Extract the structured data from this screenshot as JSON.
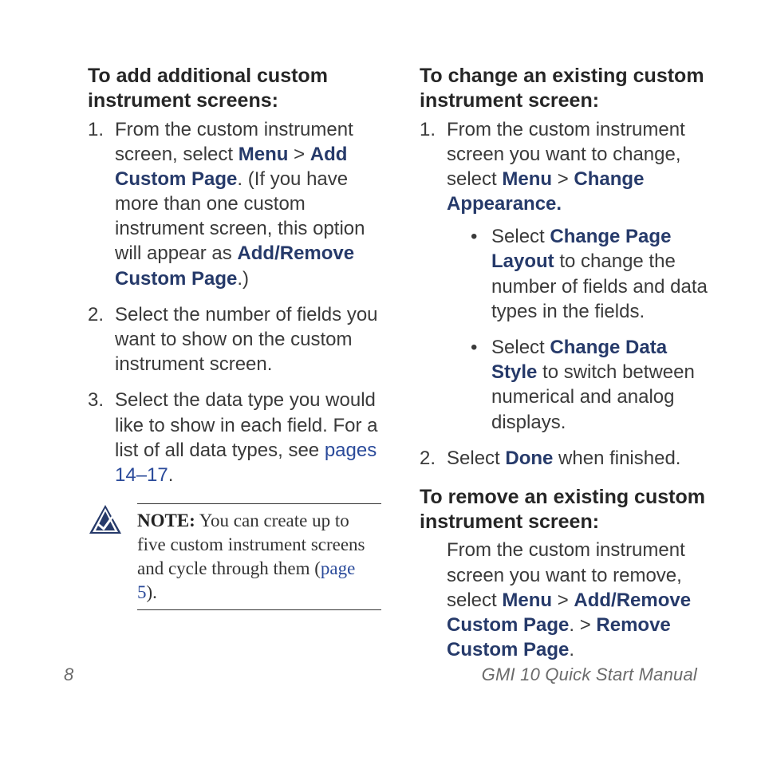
{
  "footer": {
    "page_number": "8",
    "manual_title": "GMI 10 Quick Start Manual"
  },
  "colors": {
    "ui_term": "#263a6a",
    "link": "#2a4a9a"
  },
  "note": {
    "label": "NOTE:",
    "text_pre": " You can create up to five custom instrument screens and cycle through them (",
    "link": "page 5",
    "text_post": ")."
  },
  "left": {
    "heading": "To add additional custom instrument screens:",
    "step1": {
      "t0": "From the custom instrument screen, select ",
      "ui0": "Menu",
      "t1": " > ",
      "ui1": "Add Custom Page",
      "t2": ". (If you have more than one custom instrument screen, this option will appear as ",
      "ui2": "Add/Remove Custom Page",
      "t3": ".)"
    },
    "step2": "Select the number of fields you want to show on the custom instrument screen.",
    "step3": {
      "t0": "Select the data type you would like to show in each field. For a list of all data types, see ",
      "link": "pages 14–17",
      "t1": "."
    }
  },
  "right": {
    "heading_change": "To change an existing custom instrument screen:",
    "change_step1": {
      "t0": "From the custom instrument screen you want to change, select ",
      "ui0": "Menu",
      "t1": " > ",
      "ui1": "Change Appearance."
    },
    "change_sub1": {
      "t0": "Select ",
      "ui0": "Change Page Layout",
      "t1": " to change the number of fields and data types in the fields."
    },
    "change_sub2": {
      "t0": "Select ",
      "ui0": "Change Data Style",
      "t1": " to switch between numerical and analog displays."
    },
    "change_step2": {
      "t0": "Select ",
      "ui0": "Done",
      "t1": " when finished."
    },
    "heading_remove": "To remove an existing custom instrument screen:",
    "remove_block": {
      "t0": "From the custom instrument screen you want to remove, select ",
      "ui0": "Menu",
      "t1": " > ",
      "ui1": "Add/Remove Custom Page",
      "t2": ". > ",
      "ui2": "Remove Custom Page",
      "t3": "."
    }
  }
}
